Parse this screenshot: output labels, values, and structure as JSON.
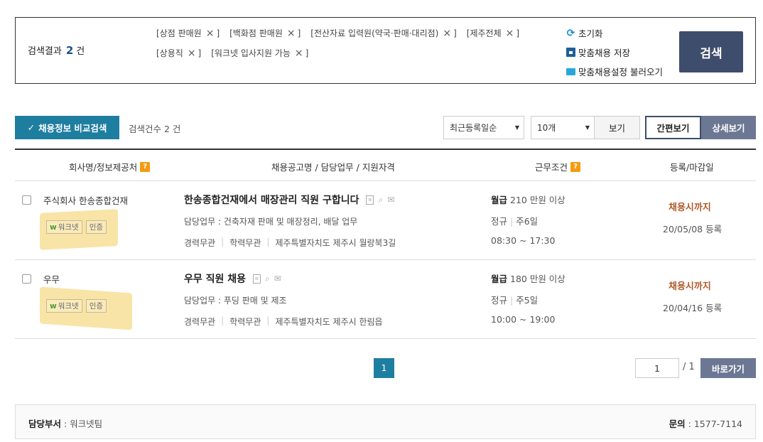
{
  "search": {
    "result_label": "검색결과",
    "result_count": "2",
    "result_unit": "건",
    "tags_row1": [
      "[상점 판매원",
      "[백화점 판매원",
      "[전산자료 입력원(약국·판매·대리점)",
      "[제주전체"
    ],
    "tags_row2": [
      "[상용직",
      "[워크넷 입사지원 가능"
    ],
    "tag_close": "×",
    "tag_suffix": "]",
    "reset_label": "초기화",
    "save_label": "맞춤채용 저장",
    "load_label": "맞춤채용설정 불러오기",
    "search_button": "검색"
  },
  "toolbar": {
    "compare_label": "채용정보 비교검색",
    "search_count": "검색건수 2 건",
    "sort_value": "최근등록일순",
    "per_page_value": "10개",
    "view_label": "보기",
    "simple_view": "간편보기",
    "detail_view": "상세보기"
  },
  "table": {
    "headers": {
      "company": "회사명/정보제공처",
      "job": "채용공고명 / 담당업무 / 지원자격",
      "conditions": "근무조건",
      "dates": "등록/마감일"
    },
    "help_mark": "?",
    "rows": [
      {
        "company": "주식회사 한송종합건재",
        "badge_worknet": "워크넷",
        "badge_cert": "인증",
        "title": "한송종합건재에서 매장관리 직원 구합니다",
        "duty": "담당업무 : 건축자재 판매 및 매장정리, 배달 업무",
        "career": "경력무관",
        "education": "학력무관",
        "location": "제주특별자치도 제주시 월랑북3길",
        "pay_type": "월급",
        "pay_amount": "210 만원 이상",
        "employment": "정규",
        "workdays": "주6일",
        "hours": "08:30 ~ 17:30",
        "deadline": "채용시까지",
        "registered": "20/05/08 등록"
      },
      {
        "company": "우무",
        "badge_worknet": "워크넷",
        "badge_cert": "인증",
        "title": "우무 직원 채용",
        "duty": "담당업무 : 푸딩 판매 및 제조",
        "career": "경력무관",
        "education": "학력무관",
        "location": "제주특별자치도 제주시 한림읍",
        "pay_type": "월급",
        "pay_amount": "180 만원 이상",
        "employment": "정규",
        "workdays": "주5일",
        "hours": "10:00 ~ 19:00",
        "deadline": "채용시까지",
        "registered": "20/04/16 등록"
      }
    ]
  },
  "pagination": {
    "current": "1",
    "input_value": "1",
    "total": "/ 1",
    "go_label": "바로가기"
  },
  "footer": {
    "dept_label": "담당부서",
    "dept_value": ": 워크넷팀",
    "inquiry_label": "문의",
    "inquiry_value": ": 1577-7114"
  },
  "colors": {
    "accent": "#1e7ea0",
    "navy": "#3e4d6c",
    "deadline": "#b15a2a",
    "highlight": "#f6d678"
  }
}
